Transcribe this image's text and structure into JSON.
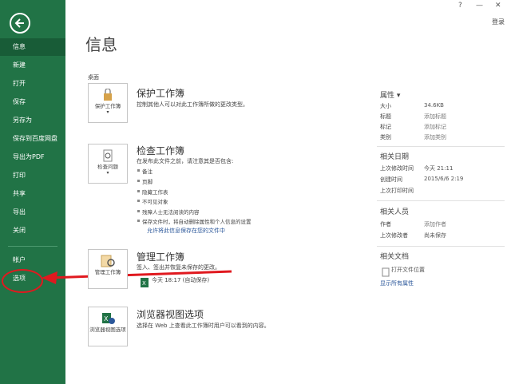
{
  "sidebar": {
    "items": [
      {
        "label": "信息"
      },
      {
        "label": "新建"
      },
      {
        "label": "打开"
      },
      {
        "label": "保存"
      },
      {
        "label": "另存为"
      },
      {
        "label": "保存到百度网盘"
      },
      {
        "label": "导出为PDF"
      },
      {
        "label": "打印"
      },
      {
        "label": "共享"
      },
      {
        "label": "导出"
      },
      {
        "label": "关闭"
      },
      {
        "label": "帐户"
      },
      {
        "label": "选项"
      }
    ]
  },
  "topbar": {
    "help": "?",
    "minimize": "—",
    "close": "✕",
    "signin": "登录"
  },
  "main": {
    "title": "信息",
    "location": "桌面",
    "protect": {
      "card_label": "保护工作簿",
      "title": "保护工作簿",
      "desc": "控制其他人可以对此工作簿所做的更改类型。"
    },
    "inspect": {
      "card_label": "检查问题",
      "title": "检查工作簿",
      "desc": "在发布此文件之前，请注意其是否包含:",
      "bullets": [
        "备注",
        "页脚",
        "隐藏工作表",
        "不可见对象",
        "残障人士无法阅读的内容",
        "保存文件时，将自动删除属性和个人信息的设置"
      ],
      "link": "允许将此信息保存在您的文件中"
    },
    "manage": {
      "card_label": "管理工作簿",
      "title": "管理工作簿",
      "desc": "签入、签出并恢复未保存的更改。",
      "autosave": "今天 18:17 (自动保存)"
    },
    "browser": {
      "card_label": "浏览器视图选项",
      "title": "浏览器视图选项",
      "desc": "选择在 Web 上查看此工作簿时用户可以看到的内容。"
    }
  },
  "properties": {
    "header": "属性 ▾",
    "rows": [
      {
        "key": "大小",
        "value": "34.6KB"
      },
      {
        "key": "标题",
        "value": "添加标题"
      },
      {
        "key": "标记",
        "value": "添加标记"
      },
      {
        "key": "类别",
        "value": "添加类别"
      }
    ],
    "dates_header": "相关日期",
    "dates": [
      {
        "key": "上次修改时间",
        "value": "今天 21:11"
      },
      {
        "key": "创建时间",
        "value": "2015/6/6 2:19"
      },
      {
        "key": "上次打印时间",
        "value": ""
      }
    ],
    "people_header": "相关人员",
    "people": [
      {
        "key": "作者",
        "value": "添加作者"
      },
      {
        "key": "上次修改者",
        "value": "尚未保存"
      }
    ],
    "docs_header": "相关文档",
    "open_location": "打开文件位置",
    "show_all": "显示所有属性"
  },
  "colors": {
    "brand": "#217346",
    "brand_dark": "#185c37",
    "annotation": "#e0191f",
    "link": "#2b579a"
  }
}
